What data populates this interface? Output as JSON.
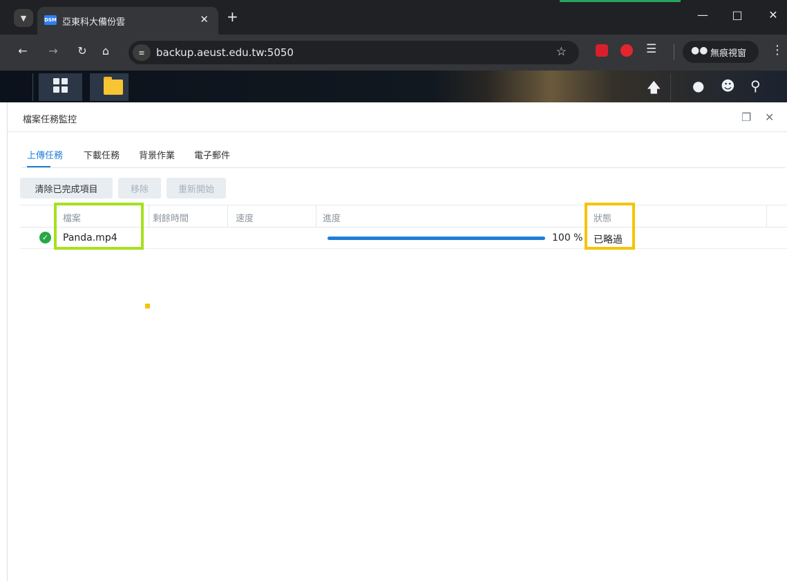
{
  "browser": {
    "tab_title": "亞東科大備份雲",
    "favicon_text": "DSM",
    "url": "backup.aeust.edu.tw:5050",
    "incognito_label": "無痕視窗",
    "colors": {
      "frame": "#202124",
      "toolbar": "#35363a"
    }
  },
  "dsm": {
    "icons": [
      "main-menu-icon",
      "file-station-icon",
      "upload-queue-icon",
      "notification-icon",
      "user-icon",
      "search-icon"
    ]
  },
  "panel": {
    "title": "檔案任務監控",
    "tabs": [
      {
        "label": "上傳任務",
        "active": true
      },
      {
        "label": "下載任務",
        "active": false
      },
      {
        "label": "背景作業",
        "active": false
      },
      {
        "label": "電子郵件",
        "active": false
      }
    ],
    "buttons": {
      "clear_completed": "清除已完成項目",
      "remove": "移除",
      "restart": "重新開始"
    },
    "columns": {
      "file": "檔案",
      "remaining_time": "剩餘時間",
      "speed": "速度",
      "progress": "進度",
      "status": "狀態"
    },
    "rows": [
      {
        "file": "Panda.mp4",
        "remaining_time": "",
        "speed": "",
        "progress": 100,
        "progress_text": "100 %",
        "status": "已略過"
      }
    ]
  },
  "colors": {
    "accent": "#1f7ed8",
    "success": "#27a844",
    "highlight_green": "#a6e01e",
    "highlight_yellow": "#f5c400"
  }
}
